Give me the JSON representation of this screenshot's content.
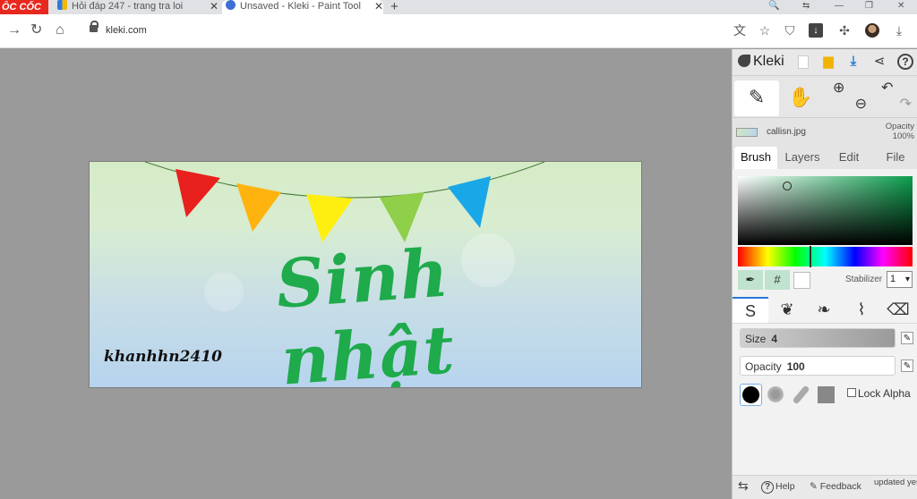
{
  "browser": {
    "brand": "ÔC CỐC",
    "tabs": [
      {
        "title": "Hỏi đáp 247 - trang tra loi"
      },
      {
        "title": "Unsaved - Kleki - Paint Tool"
      }
    ],
    "new_tab": "+",
    "url": "kleki.com"
  },
  "canvas": {
    "title_text": "Sinh nhật",
    "signature": "khanhhn2410",
    "bunting_colors": [
      "#e8201e",
      "#ffb30f",
      "#ffef11",
      "#8fcf4a",
      "#1aa7e8"
    ]
  },
  "kleki": {
    "logo": "Kleki",
    "layer": {
      "name": "callisn.jpg",
      "opacity_label": "Opacity",
      "opacity_value": "100%"
    },
    "tabs": [
      "Brush",
      "Layers",
      "Edit",
      "File"
    ],
    "color": {
      "primary_green": "#0b9e4c"
    },
    "stabilizer": {
      "label": "Stabilizer",
      "value": "1"
    },
    "size": {
      "label": "Size",
      "value": "4"
    },
    "opacity": {
      "label": "Opacity",
      "value": "100"
    },
    "lock_alpha": "Lock Alpha",
    "footer": {
      "help": "Help",
      "feedback": "Feedback",
      "updated": "updated yesterday"
    }
  }
}
